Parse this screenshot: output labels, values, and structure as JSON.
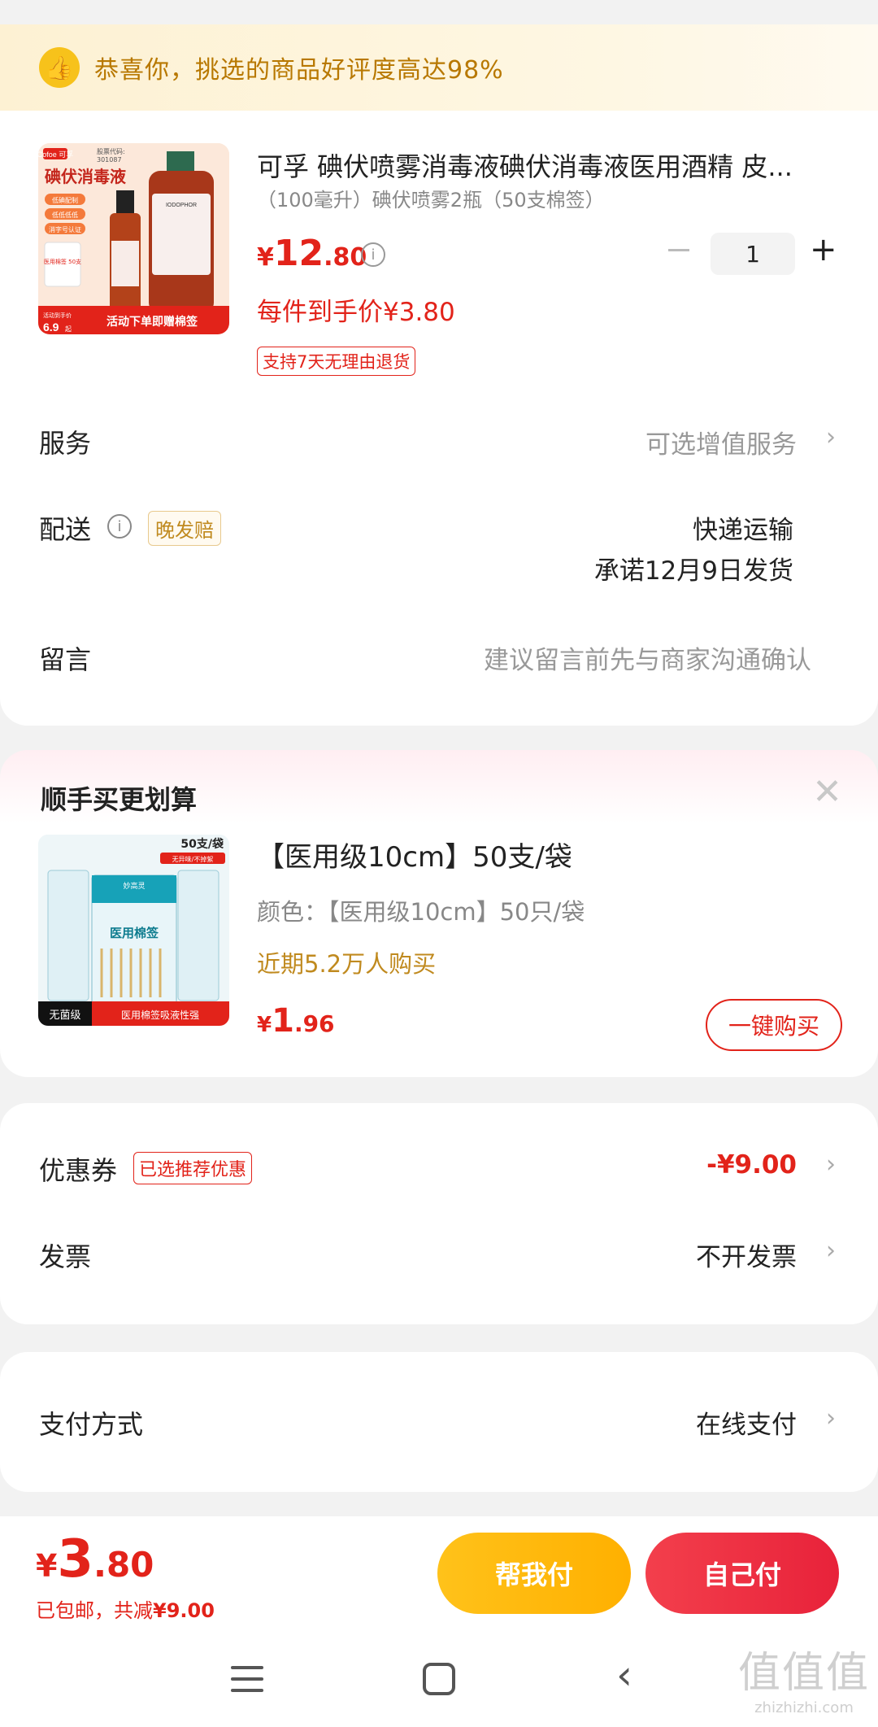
{
  "banner": {
    "icon": "thumbs-up-icon",
    "text": "恭喜你，挑选的商品好评度高达98%"
  },
  "product": {
    "title": "可孚 碘伏喷雾消毒液碘伏消毒液医用酒精 皮...",
    "spec": "（100毫升）碘伏喷雾2瓶（50支棉签）",
    "price_symbol": "¥",
    "price_int": "12",
    "price_dec": ".80",
    "final_price": "每件到手价¥3.80",
    "return_tag": "支持7天无理由退货",
    "quantity": "1",
    "image": {
      "brand": "Cofoe 可孚",
      "code_label": "股票代码:",
      "code": "301087",
      "name": "碘伏消毒液",
      "features": [
        "低碘配制",
        "低低低低",
        "消字号认证"
      ],
      "side": "IODOPHOR",
      "swabs": "医用棉签 50支",
      "promo_label": "活动到手价",
      "promo_price": "6.9",
      "promo_unit": "起",
      "promo": "活动下单即赠棉签"
    }
  },
  "rows": {
    "service_label": "服务",
    "service_value": "可选增值服务",
    "delivery_label": "配送",
    "delivery_tag": "晚发赔",
    "delivery_method": "快递运输",
    "delivery_promise": "承诺12月9日发货",
    "message_label": "留言",
    "message_placeholder": "建议留言前先与商家沟通确认"
  },
  "upsell": {
    "title": "顺手买更划算",
    "product_title": "【医用级10cm】50支/袋",
    "color": "颜色：【医用级10cm】50只/袋",
    "sales": "近期5.2万人购买",
    "price_symbol": "¥",
    "price_int": "1",
    "price_dec": ".96",
    "buy_label": "一键购买",
    "image": {
      "qty": "50支/袋",
      "badge": "无异味/不掉絮",
      "brand": "妙高灵",
      "name": "医用棉签",
      "footer_left": "无菌级",
      "footer_right": "医用棉签吸液性强"
    }
  },
  "payment": {
    "coupon_label": "优惠券",
    "coupon_tag": "已选推荐优惠",
    "coupon_value": "-¥9.00",
    "invoice_label": "发票",
    "invoice_value": "不开发票",
    "method_label": "支付方式",
    "method_value": "在线支付"
  },
  "footer": {
    "total_symbol": "¥",
    "total_int": "3",
    "total_dec": ".80",
    "sub_prefix": "已包邮，共减",
    "sub_amount": "¥9.00",
    "help_pay": "帮我付",
    "self_pay": "自己付"
  },
  "nav": {
    "menu": "menu-icon",
    "home": "home-icon",
    "back": "back-icon"
  },
  "watermark": {
    "big": "值值值",
    "small": "zhizhizhi.com"
  },
  "colors": {
    "accent": "#e2231a",
    "gold": "#c08a1f",
    "help_btn": "#ffb800",
    "self_btn": "#ee2f43"
  }
}
